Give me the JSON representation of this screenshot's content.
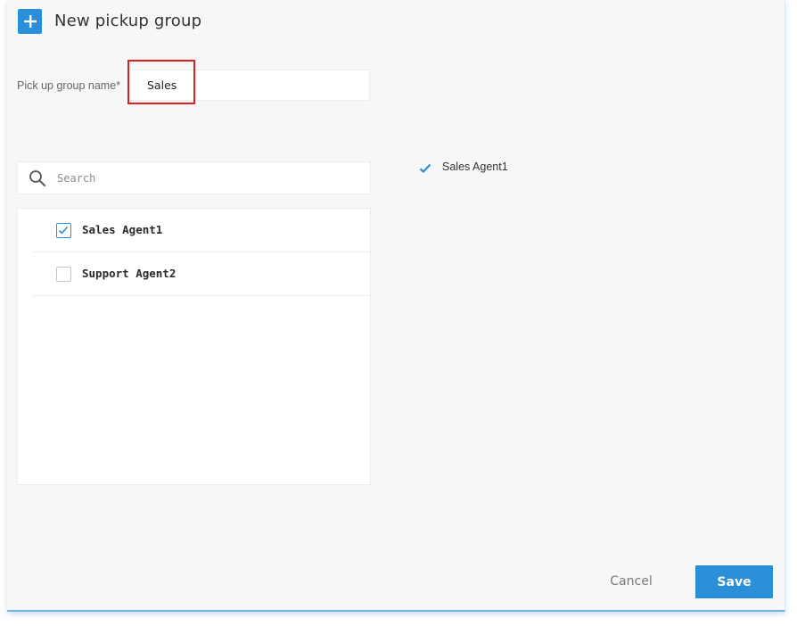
{
  "header": {
    "title": "New pickup group",
    "add_icon": "plus-icon"
  },
  "form": {
    "name_label": "Pick up group name*",
    "name_value": "Sales"
  },
  "search": {
    "placeholder": "Search",
    "icon": "search-icon"
  },
  "agents": [
    {
      "label": "Sales Agent1",
      "checked": true
    },
    {
      "label": "Support Agent2",
      "checked": false
    }
  ],
  "selected": [
    {
      "label": "Sales Agent1",
      "icon": "checkmark-icon"
    }
  ],
  "footer": {
    "cancel_label": "Cancel",
    "save_label": "Save"
  },
  "colors": {
    "accent": "#2a8fd8",
    "highlight": "#e02020",
    "background": "#f7f7f7"
  }
}
